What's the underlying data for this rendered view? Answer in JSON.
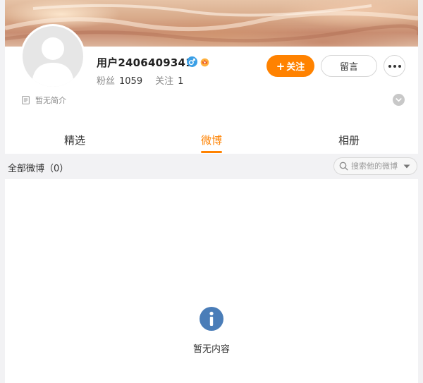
{
  "profile": {
    "username": "用户2406409341",
    "fans_label": "粉丝",
    "fans_count": "1059",
    "follow_label": "关注",
    "follow_count": "1",
    "bio": "暂无简介",
    "gender_icon": "male-icon",
    "badge_icon": "crown-badge-icon"
  },
  "actions": {
    "follow_plus": "+",
    "follow_label": "关注",
    "message_label": "留言",
    "more_icon": "more-dots-icon"
  },
  "tabs": [
    {
      "label": "精选",
      "active": false
    },
    {
      "label": "微博",
      "active": true
    },
    {
      "label": "相册",
      "active": false
    }
  ],
  "filter": {
    "label": "全部微博（0）",
    "search_placeholder": "搜索他的微博"
  },
  "empty_state": {
    "message": "暂无内容",
    "icon": "info-icon"
  },
  "colors": {
    "accent": "#ff8200",
    "info_icon": "#4a7db8",
    "gender_male": "#3a9fe6"
  }
}
